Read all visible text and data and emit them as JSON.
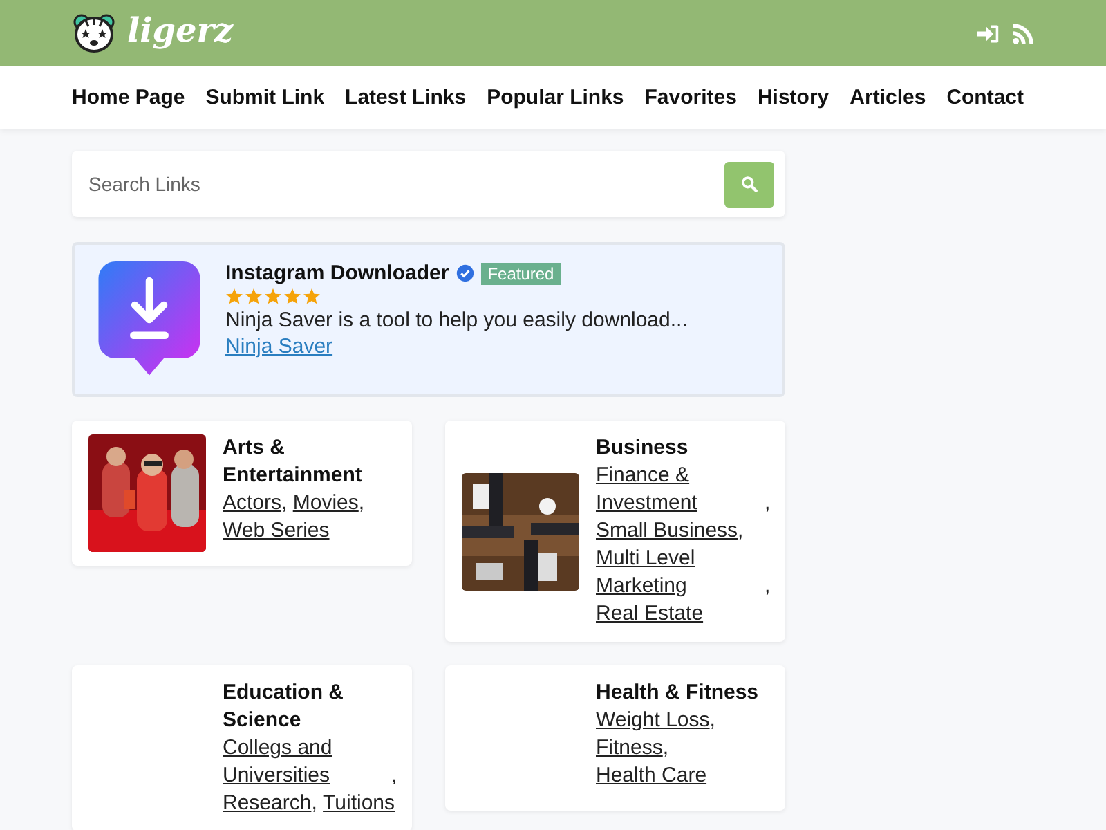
{
  "header": {
    "logo_text": "ligerz"
  },
  "nav": {
    "items": [
      {
        "label": "Home Page"
      },
      {
        "label": "Submit Link"
      },
      {
        "label": "Latest Links"
      },
      {
        "label": "Popular Links"
      },
      {
        "label": "Favorites"
      },
      {
        "label": "History"
      },
      {
        "label": "Articles"
      },
      {
        "label": "Contact"
      }
    ]
  },
  "search": {
    "placeholder": "Search Links"
  },
  "featured": {
    "title": "Instagram Downloader",
    "verified": true,
    "badge": "Featured",
    "stars": 5,
    "description": "Ninja Saver is a tool to help you easily download...",
    "link": "Ninja Saver"
  },
  "categories": [
    {
      "title": "Arts & Entertainment",
      "image": {
        "kind": "picture"
      },
      "links": [
        {
          "label": "Actors",
          "separator": ","
        },
        {
          "label": "Movies",
          "separator": ","
        },
        {
          "label": "Web Series"
        }
      ]
    },
    {
      "title": "Business",
      "image": {
        "kind": "picture"
      },
      "links": [
        {
          "label": "Finance & Investment",
          "separator": ","
        },
        {
          "label": "Small Business",
          "separator": ","
        },
        {
          "label": "Multi Level Marketing",
          "separator": ","
        },
        {
          "label": "Real Estate"
        }
      ]
    },
    {
      "title": "Education & Science",
      "links": [
        {
          "label": "Collegs and Universities",
          "separator": ","
        },
        {
          "label": "Research",
          "separator": ","
        },
        {
          "label": "Tuitions"
        }
      ]
    },
    {
      "title": "Health & Fitness",
      "links": [
        {
          "label": "Weight Loss",
          "separator": ","
        },
        {
          "label": "Fitness",
          "separator": ","
        },
        {
          "label": "Health Care"
        }
      ]
    }
  ]
}
